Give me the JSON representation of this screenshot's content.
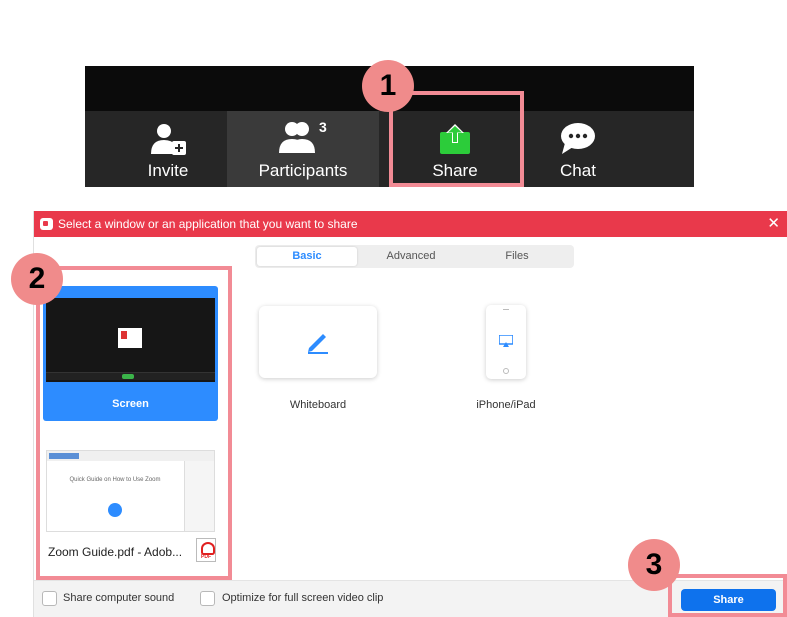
{
  "toolbar": {
    "invite_label": "Invite",
    "participants_label": "Participants",
    "participants_count": "3",
    "share_label": "Share",
    "chat_label": "Chat",
    "share_icon_color": "#2ccc3a"
  },
  "callouts": [
    "1",
    "2",
    "3"
  ],
  "dialog": {
    "title": "Select a window or an application that you want to share",
    "close_glyph": "✕",
    "tabs": [
      {
        "label": "Basic",
        "selected": true
      },
      {
        "label": "Advanced",
        "selected": false
      },
      {
        "label": "Files",
        "selected": false
      }
    ],
    "sources": [
      {
        "label": "Screen",
        "selected": true
      },
      {
        "label": "Zoom Guide.pdf - Adob...",
        "selected": false
      }
    ],
    "guide_thumb_text": "Quick Guide on How to Use Zoom",
    "pdf_icon_text": "PDF",
    "whiteboard_label": "Whiteboard",
    "iphone_label": "iPhone/iPad",
    "footer": {
      "sound_label": "Share computer sound",
      "optimize_label": "Optimize for full screen video clip",
      "share_button": "Share"
    }
  },
  "colors": {
    "title_bar": "#e9394b",
    "accent_blue": "#2d8cff",
    "share_button": "#0e72ed",
    "callout": "#f28b95"
  }
}
